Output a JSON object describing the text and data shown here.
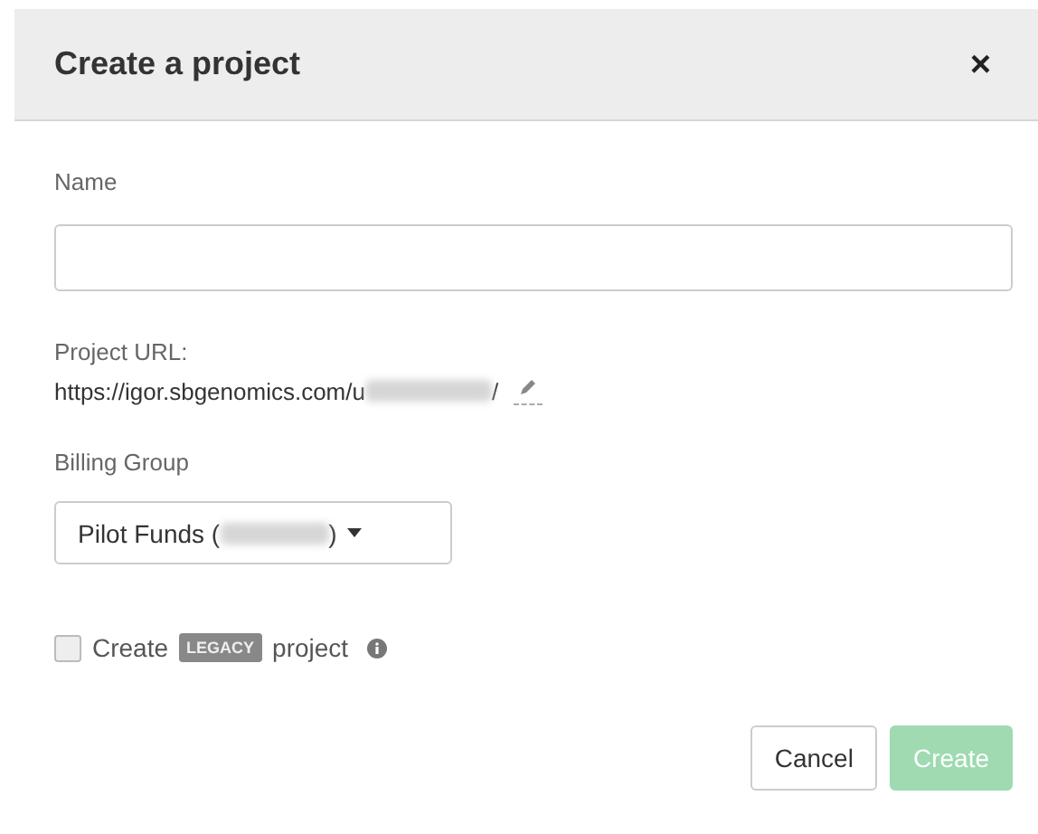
{
  "dialog": {
    "title": "Create a project",
    "close": "×"
  },
  "name_field": {
    "label": "Name"
  },
  "project_url": {
    "label": "Project URL:",
    "prefix": "https://igor.sbgenomics.com/u",
    "suffix": "/"
  },
  "billing_group": {
    "label": "Billing Group",
    "value_start": "Pilot Funds (",
    "value_end": ")"
  },
  "legacy": {
    "checked": false,
    "before": "Create",
    "badge": "LEGACY",
    "after": "project"
  },
  "buttons": [
    {
      "label": "Cancel",
      "kind": "secondary",
      "disabled": false
    },
    {
      "label": "Create",
      "kind": "primary",
      "disabled": true
    }
  ]
}
